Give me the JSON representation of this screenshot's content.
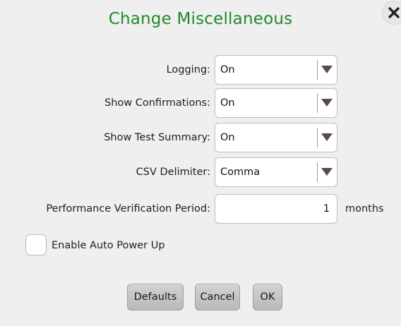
{
  "dialog": {
    "title": "Change Miscellaneous",
    "close_icon": "close-icon"
  },
  "fields": {
    "logging": {
      "label": "Logging:",
      "value": "On"
    },
    "show_confirmations": {
      "label": "Show Confirmations:",
      "value": "On"
    },
    "show_test_summary": {
      "label": "Show Test Summary:",
      "value": "On"
    },
    "csv_delimiter": {
      "label": "CSV Delimiter:",
      "value": "Comma"
    },
    "perf_verification": {
      "label": "Performance Verification Period:",
      "value": "1",
      "unit": "months"
    }
  },
  "auto_power_up": {
    "label": "Enable Auto Power Up",
    "checked": false
  },
  "buttons": {
    "defaults": "Defaults",
    "cancel": "Cancel",
    "ok": "OK"
  },
  "colors": {
    "title": "#1f8a2a",
    "arrow": "#5a4a48"
  }
}
